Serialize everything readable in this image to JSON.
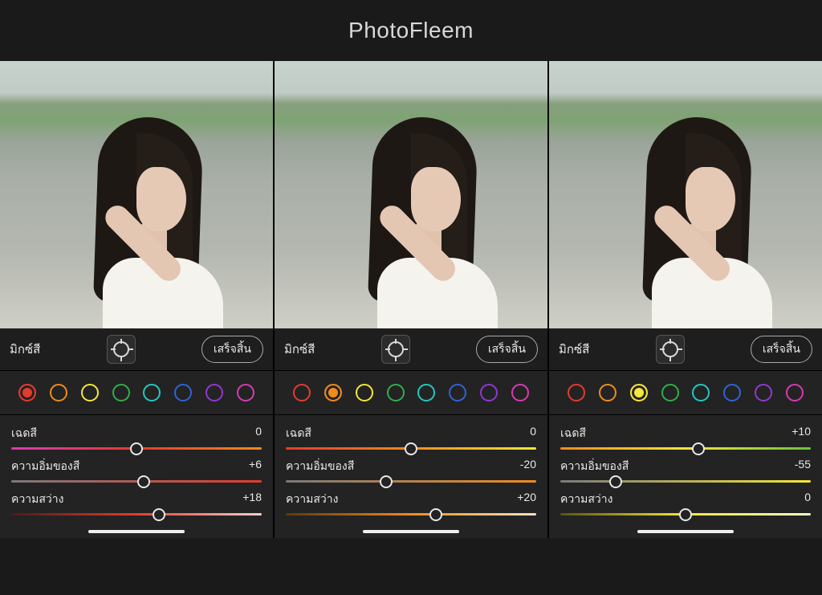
{
  "brand": "PhotoFleem",
  "toolbar": {
    "mix_label": "มิกซ์สี",
    "done_label": "เสร็จสิ้น"
  },
  "swatch_colors": [
    "#e43b2f",
    "#ef8b1f",
    "#f5e63b",
    "#2fae4b",
    "#25c7c0",
    "#2f63d6",
    "#8e39d1",
    "#d63bb3"
  ],
  "slider_labels": {
    "hue": "เฉดสี",
    "sat": "ความอิ่มของสี",
    "lum": "ความสว่าง"
  },
  "panels": [
    {
      "selected_swatch": 0,
      "hue": 0,
      "sat": 6,
      "lum": 18,
      "gradients": {
        "hue": "linear-gradient(90deg,#d83bb3,#e43b2f,#ef8b1f)",
        "sat": "linear-gradient(90deg,#7a7a7a,#e43b2f)",
        "lum": "linear-gradient(90deg,#4a1d18,#e43b2f,#f6cfc9)"
      }
    },
    {
      "selected_swatch": 1,
      "hue": 0,
      "sat": -20,
      "lum": 20,
      "gradients": {
        "hue": "linear-gradient(90deg,#e43b2f,#ef8b1f,#f5e63b)",
        "sat": "linear-gradient(90deg,#7a7a7a,#ef8b1f)",
        "lum": "linear-gradient(90deg,#5a3a12,#ef8b1f,#f9e1bf)"
      }
    },
    {
      "selected_swatch": 2,
      "hue": 10,
      "sat": -55,
      "lum": 0,
      "gradients": {
        "hue": "linear-gradient(90deg,#ef8b1f,#f5e63b,#6ac23b)",
        "sat": "linear-gradient(90deg,#7a7a7a,#f5e63b)",
        "lum": "linear-gradient(90deg,#5a5212,#f5e63b,#fbf6c9)"
      }
    }
  ]
}
